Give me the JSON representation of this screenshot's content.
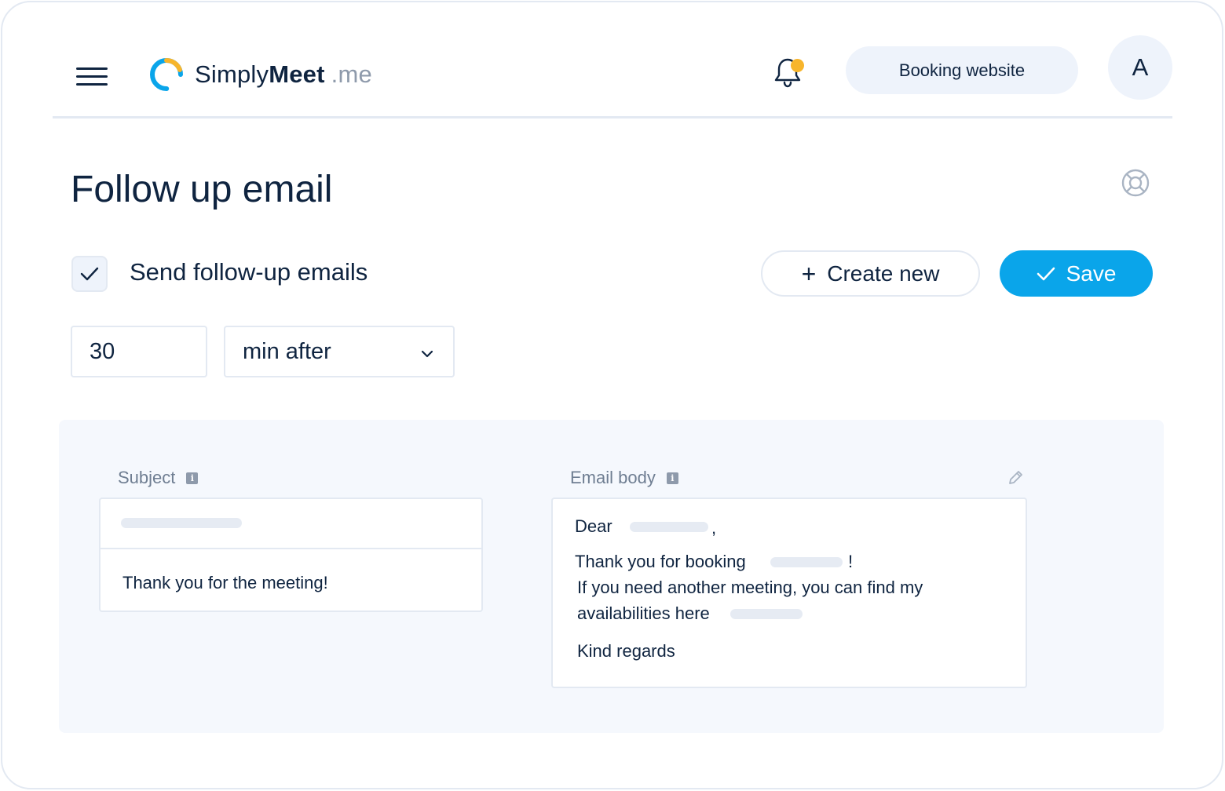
{
  "header": {
    "logo": {
      "name_part1": "Simply",
      "name_part2": "Meet",
      "name_suffix": ".me"
    },
    "booking_button": "Booking website",
    "avatar_initial": "A"
  },
  "page": {
    "title": "Follow up email"
  },
  "settings": {
    "send_followup_label": "Send follow-up emails",
    "send_followup_checked": true,
    "create_button": "Create new",
    "save_button": "Save",
    "delay_value": "30",
    "delay_unit": "min after"
  },
  "editor": {
    "subject_label": "Subject",
    "subject_text": "Thank you for the meeting!",
    "body_label": "Email body",
    "body_lines": {
      "greeting": "Dear",
      "greeting_suffix": ",",
      "thanks": "Thank you for booking",
      "thanks_suffix": "!",
      "line3": "If you need another meeting, you can find my",
      "line4": "availabilities here",
      "closing": "Kind regards"
    }
  },
  "icons": {
    "menu": "hamburger-menu-icon",
    "logo": "logo-ring-icon",
    "notifications": "bell-icon",
    "help": "lifebuoy-icon",
    "check": "checkmark-icon",
    "plus": "plus-icon",
    "dropdown": "chevron-down-icon",
    "info": "info-icon",
    "edit": "pencil-icon"
  },
  "colors": {
    "primary": "#0aa5ea",
    "text": "#0f2440",
    "notification_dot": "#f7b52c",
    "logo_blue": "#0aa5ea",
    "logo_yellow": "#f7b52c",
    "panel_bg": "#f5f8fd"
  }
}
